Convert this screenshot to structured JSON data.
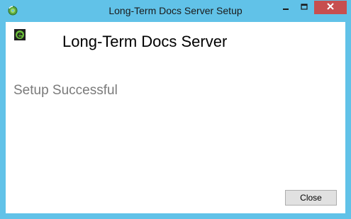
{
  "window": {
    "title": "Long-Term Docs Server Setup",
    "accent_color": "#61c2e8",
    "close_hover_color": "#c74f4f",
    "icons": {
      "app": "setup-disc-icon",
      "minimize": "minimize-icon",
      "maximize": "maximize-icon",
      "close": "close-icon"
    }
  },
  "content": {
    "product_logo_icon": "product-logo-icon",
    "product_name": "Long-Term Docs Server",
    "status": "Setup Successful"
  },
  "footer": {
    "close_label": "Close"
  }
}
